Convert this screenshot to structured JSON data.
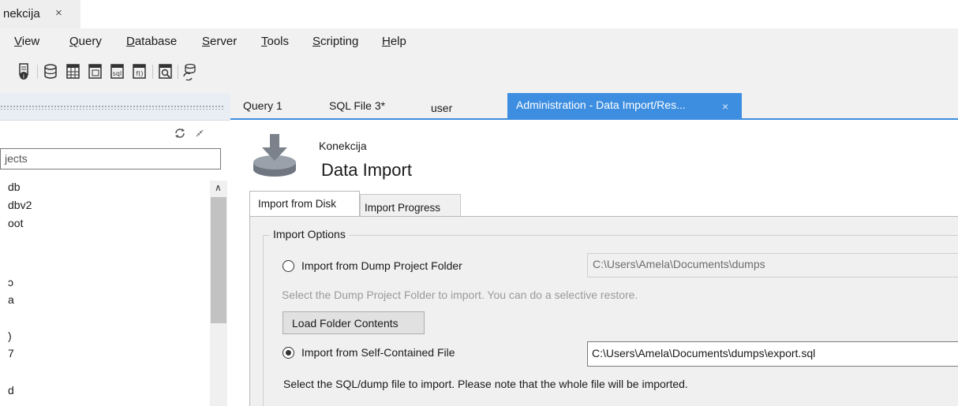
{
  "window_tab": {
    "label": "nekcija",
    "close": "×"
  },
  "menu": [
    {
      "label": "View",
      "mnemonic": "V",
      "rest": "iew"
    },
    {
      "label": "Query",
      "mnemonic": "Q",
      "rest": "uery"
    },
    {
      "label": "Database",
      "mnemonic": "D",
      "rest": "atabase"
    },
    {
      "label": "Server",
      "mnemonic": "S",
      "rest": "erver"
    },
    {
      "label": "Tools",
      "mnemonic": "T",
      "rest": "ools"
    },
    {
      "label": "Scripting",
      "mnemonic": "S",
      "rest": "cripting"
    },
    {
      "label": "Help",
      "mnemonic": "H",
      "rest": "elp"
    }
  ],
  "toolbar_icons": [
    "server-info-icon",
    "create-schema-icon",
    "create-table-icon",
    "create-view-icon",
    "create-procedure-icon",
    "create-function-icon",
    "search-table-data-icon",
    "reconnect-icon"
  ],
  "sidebar": {
    "filter_placeholder": "jects",
    "schemas": [
      "db",
      "dbv2",
      "oot",
      "ɔ",
      "a",
      ")",
      "7",
      "d"
    ]
  },
  "doc_tabs": {
    "query": "Query 1",
    "sqlfile": "SQL File 3*",
    "user": "user",
    "admin": "Administration - Data Import/Res...",
    "admin_close": "×"
  },
  "header": {
    "connection": "Konekcija",
    "title": "Data Import"
  },
  "inner_tabs": {
    "disk": "Import from Disk",
    "progress": "Import Progress"
  },
  "options": {
    "legend": "Import Options",
    "folder": {
      "label": "Import from Dump Project Folder",
      "path": "C:\\Users\\Amela\\Documents\\dumps",
      "hint": "Select the Dump Project Folder to import. You can do a selective restore.",
      "selected": false
    },
    "load_button": "Load Folder Contents",
    "file": {
      "label": "Import from Self-Contained File",
      "path": "C:\\Users\\Amela\\Documents\\dumps\\export.sql",
      "hint": "Select the SQL/dump file to import. Please note that the whole file will be imported.",
      "selected": true
    }
  },
  "colors": {
    "accent": "#3d8ee0",
    "chrome": "#f1f1f1",
    "panel": "#f0f0f0"
  }
}
